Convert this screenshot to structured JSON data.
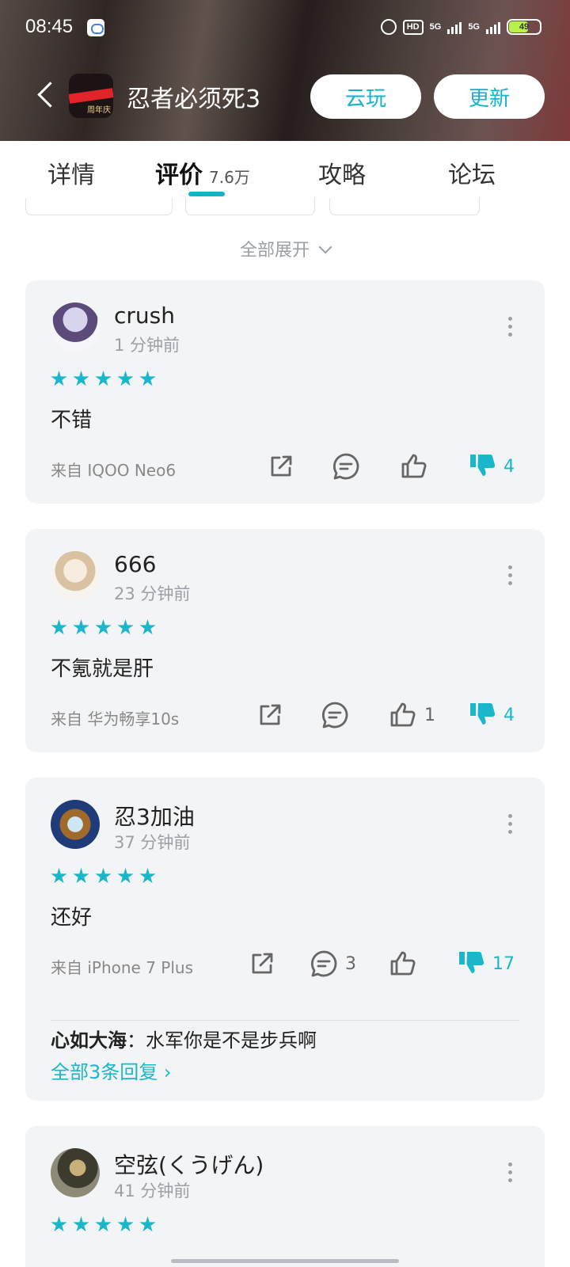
{
  "status_bar": {
    "time": "08:45",
    "hd": "HD",
    "net1": "5G",
    "net2": "5G",
    "battery": "49"
  },
  "header": {
    "app_title": "忍者必须死3",
    "icon_mark": "周年庆",
    "cloud_play": "云玩",
    "update": "更新"
  },
  "tabs": {
    "detail": "详情",
    "review": "评价",
    "review_count": "7.6万",
    "guide": "攻略",
    "forum": "论坛"
  },
  "expand_all": "全部展开",
  "colors": {
    "accent": "#19b7c9",
    "card_bg": "#f3f4f6"
  },
  "reviews": [
    {
      "user": "crush",
      "time": "1 分钟前",
      "stars": 5,
      "content": "不错",
      "device": "来自 IQOO Neo6",
      "comments": "",
      "likes": "",
      "dislikes": "4"
    },
    {
      "user": "666",
      "time": "23 分钟前",
      "stars": 5,
      "content": "不氪就是肝",
      "device": "来自 华为畅享10s",
      "comments": "",
      "likes": "1",
      "dislikes": "4"
    },
    {
      "user": "忍3加油",
      "time": "37 分钟前",
      "stars": 5,
      "content": "还好",
      "device": "来自 iPhone 7 Plus",
      "comments": "3",
      "likes": "",
      "dislikes": "17",
      "reply": {
        "author": "心如大海",
        "sep": "：",
        "text": "水军你是不是步兵啊",
        "more": "全部3条回复"
      }
    },
    {
      "user": "空弦(くうげん)",
      "time": "41 分钟前",
      "stars": 5
    }
  ]
}
